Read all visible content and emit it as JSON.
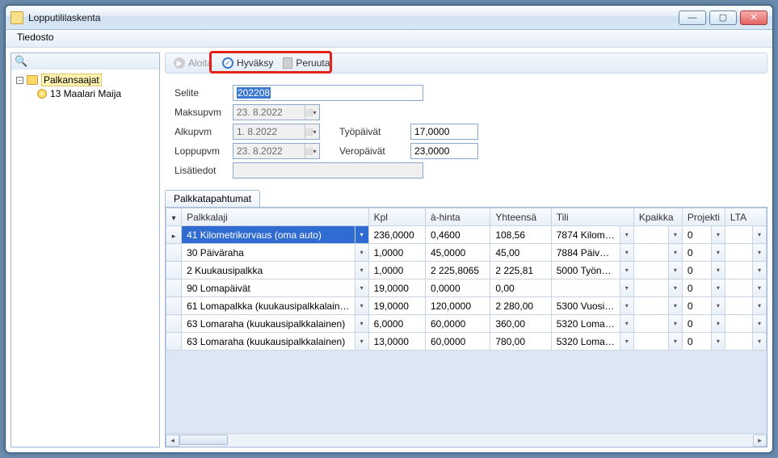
{
  "window": {
    "title": "Lopputililaskenta"
  },
  "menu": {
    "file": "Tiedosto"
  },
  "toolbar": {
    "start": "Aloita",
    "approve": "Hyväksy",
    "cancel": "Peruuta"
  },
  "tree": {
    "root": "Palkansaajat",
    "child": "13 Maalari Maija"
  },
  "form": {
    "labels": {
      "selite": "Selite",
      "maksupvm": "Maksupvm",
      "alkupvm": "Alkupvm",
      "loppupvm": "Loppupvm",
      "lisatiedot": "Lisätiedot",
      "tyopaivat": "Työpäivät",
      "veropaivat": "Veropäivät"
    },
    "values": {
      "selite": "202208",
      "maksupvm": "23. 8.2022",
      "alkupvm": " 1. 8.2022",
      "loppupvm": "23. 8.2022",
      "lisatiedot": "",
      "tyopaivat": "17,0000",
      "veropaivat": "23,0000"
    }
  },
  "tab": {
    "label": "Palkkatapahtumat"
  },
  "grid": {
    "headers": {
      "palkkalaji": "Palkkalaji",
      "kpl": "Kpl",
      "ahinta": "à-hinta",
      "yhteensa": "Yhteensä",
      "tili": "Tili",
      "kpaikka": "Kpaikka",
      "projekti": "Projekti",
      "lta": "LTA"
    },
    "rows": [
      {
        "palkkalaji": "41 Kilometrikorvaus (oma auto)",
        "kpl": "236,0000",
        "ahinta": "0,4600",
        "yht": "108,56",
        "tili": "7874 Kilom…",
        "projekti": "0"
      },
      {
        "palkkalaji": "30 Päiväraha",
        "kpl": "1,0000",
        "ahinta": "45,0000",
        "yht": "45,00",
        "tili": "7884 Päiv…",
        "projekti": "0"
      },
      {
        "palkkalaji": "2 Kuukausipalkka",
        "kpl": "1,0000",
        "ahinta": "2 225,8065",
        "yht": "2 225,81",
        "tili": "5000 Työn…",
        "projekti": "0"
      },
      {
        "palkkalaji": "90 Lomapäivät",
        "kpl": "19,0000",
        "ahinta": "0,0000",
        "yht": "0,00",
        "tili": "",
        "projekti": "0"
      },
      {
        "palkkalaji": "61 Lomapalkka (kuukausipalkkalain…",
        "kpl": "19,0000",
        "ahinta": "120,0000",
        "yht": "2 280,00",
        "tili": "5300 Vuosi…",
        "projekti": "0"
      },
      {
        "palkkalaji": "63 Lomaraha (kuukausipalkkalainen)",
        "kpl": "6,0000",
        "ahinta": "60,0000",
        "yht": "360,00",
        "tili": "5320 Loma…",
        "projekti": "0"
      },
      {
        "palkkalaji": "63 Lomaraha (kuukausipalkkalainen)",
        "kpl": "13,0000",
        "ahinta": "60,0000",
        "yht": "780,00",
        "tili": "5320 Loma…",
        "projekti": "0"
      }
    ]
  }
}
